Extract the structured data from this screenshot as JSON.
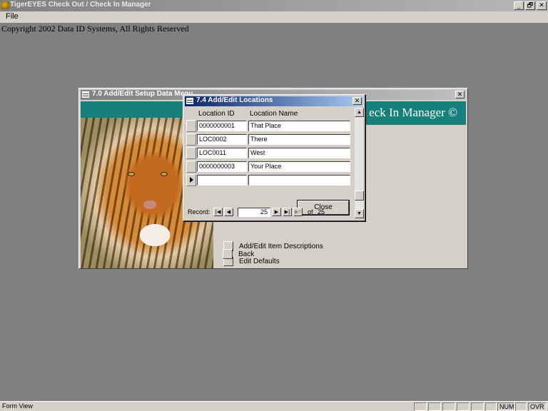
{
  "app": {
    "title": "TigerEYES Check Out / Check In Manager",
    "minimize": "_",
    "restore": "🗗",
    "close": "✕",
    "menu": [
      "File"
    ],
    "copyright": "Copyright 2002 Data ID Systems, All Rights Reserved"
  },
  "setup_form": {
    "title": "7.0 Add/Edit Setup Data Menu",
    "banner": "eck In Manager ©",
    "close": "✕",
    "buttons": [
      {
        "label": "Add/Edit Item Descriptions"
      },
      {
        "label": "Edit Defaults"
      },
      {
        "label": "Back"
      }
    ]
  },
  "locations_form": {
    "title": "7.4  Add/Edit Locations",
    "close": "✕",
    "columns": [
      "Location ID",
      "Location Name"
    ],
    "rows": [
      {
        "id": "0000000001",
        "name": "That Place"
      },
      {
        "id": "LOC0002",
        "name": "There"
      },
      {
        "id": "LOC0011",
        "name": "West"
      },
      {
        "id": "0000000003",
        "name": "Your Place"
      },
      {
        "id": "",
        "name": ""
      }
    ],
    "close_button": "Close",
    "navigation": {
      "label": "Record:",
      "first": "|◀",
      "prev": "◀",
      "current": "25",
      "next": "▶",
      "last": "▶|",
      "new": "▶*",
      "of": "of",
      "total": "25"
    },
    "scroll_up": "▲",
    "scroll_down": "▼"
  },
  "statusbar": {
    "text": "Form View",
    "indicators": [
      "NUM",
      "OVR"
    ]
  }
}
